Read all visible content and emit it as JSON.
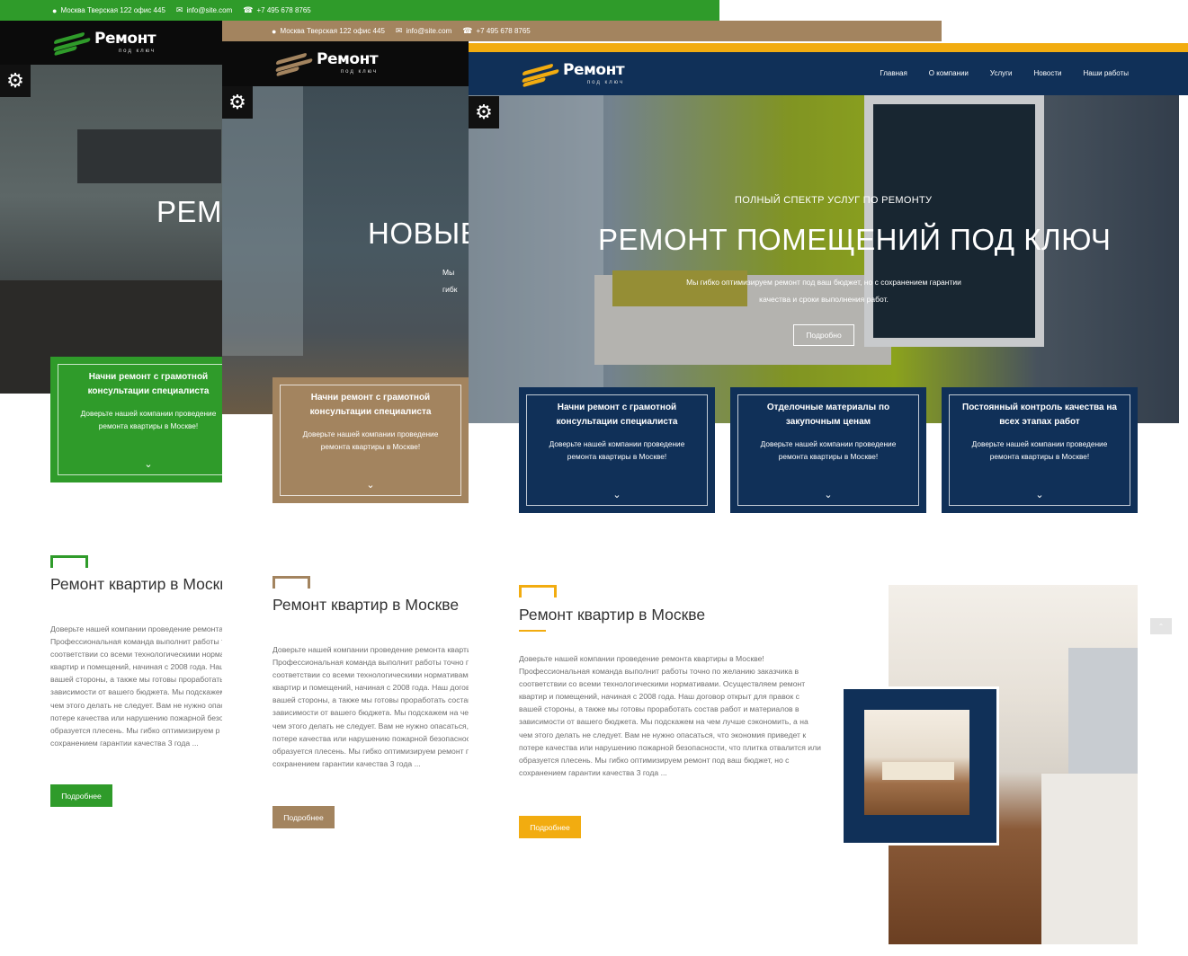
{
  "contact": {
    "address": "Москва Тверская 122 офис 445",
    "email": "info@site.com",
    "phone": "+7 495 678 8765"
  },
  "logo": {
    "main": "Ремонт",
    "sub": "под ключ"
  },
  "nav": [
    "Главная",
    "О компании",
    "Услуги",
    "Новости",
    "Наши работы"
  ],
  "hero": {
    "subtitle": "ПОЛНЫЙ СПЕКТР УСЛУГ ПО РЕМОНТУ",
    "title": "РЕМОНТ ПОМЕЩЕНИЙ ПОД КЛЮЧ",
    "title_green_partial": "РЕМС",
    "title_brown_partial": "НОВЫЕ",
    "desc_brown_partial": "Мы гибк",
    "description": "Мы гибко оптимизируем ремонт под ваш бюджет, но с сохранением гарантии\nкачества и сроки выполнения работ.",
    "button": "Подробно"
  },
  "cards": [
    {
      "title": "Начни ремонт с грамотной\nконсультации специалиста",
      "text": "Доверьте нашей компании проведение\nремонта квартиры в Москве!"
    },
    {
      "title": "Отделочные материалы по\nзакупочным ценам",
      "text": "Доверьте нашей компании проведение\nремонта квартиры в Москве!"
    },
    {
      "title": "Постоянный контроль качества на\nвсех этапах работ",
      "text": "Доверьте нашей компании проведение\nремонта квартиры в Москве!"
    }
  ],
  "about": {
    "title": "Ремонт квартир в Москве",
    "text_full": "Доверьте нашей компании проведение ремонта квартиры в Москве!\nПрофессиональная команда выполнит работы точно по желанию заказчика в\nсоответствии со всеми технологическими нормативами. Осуществляем ремонт\nквартир и помещений, начиная с 2008 года. Наш договор открыт для правок с\nвашей стороны, а также мы готовы проработать состав работ и материалов в\nзависимости от вашего бюджета. Мы подскажем на чем лучше сэкономить, а на\nчем этого делать не следует. Вам не нужно опасаться, что экономия приведет к\nпотере качества или нарушению пожарной безопасности, что плитка отвалится или\nобразуется плесень. Мы гибко оптимизируем ремонт под ваш бюджет, но с\nсохранением гарантии качества 3 года ...",
    "text_green": "Доверьте нашей компании проведение ремонта\nПрофессиональная команда выполнит работы т\nсоответствии со всеми технологическими норма\nквартир и помещений, начиная с 2008 года. Наш\nвашей стороны, а также мы готовы проработать\nзависимости от вашего бюджета. Мы подскажем\nчем этого делать не следует. Вам не нужно опас\nпотере качества или нарушению пожарной безо\nобразуется плесень. Мы гибко оптимизируем р\nсохранением гарантии качества 3 года ...",
    "text_brown": "Доверьте нашей компании проведение ремонта кварти\nПрофессиональная команда выполнит работы точно по\nсоответствии со всеми технологическими нормативами\nквартир и помещений, начиная с 2008 года. Наш догово\nвашей стороны, а также мы готовы проработать состав\nзависимости от вашего бюджета. Мы подскажем на че\nчем этого делать не следует. Вам не нужно опасаться, ч\nпотере качества или нарушению пожарной безопаснос\nобразуется плесень. Мы гибко оптимизируем ремонт п\nсохранением гарантии качества 3 года ...",
    "button": "Подробнее"
  },
  "colors": {
    "green": "#2f9b2a",
    "brown": "#a3845f",
    "navy": "#103058",
    "gold": "#f2ac10"
  },
  "icons": [
    "map-marker-icon",
    "envelope-icon",
    "phone-icon",
    "gear-icon",
    "chevron-double-down-icon",
    "chevron-up-icon"
  ]
}
